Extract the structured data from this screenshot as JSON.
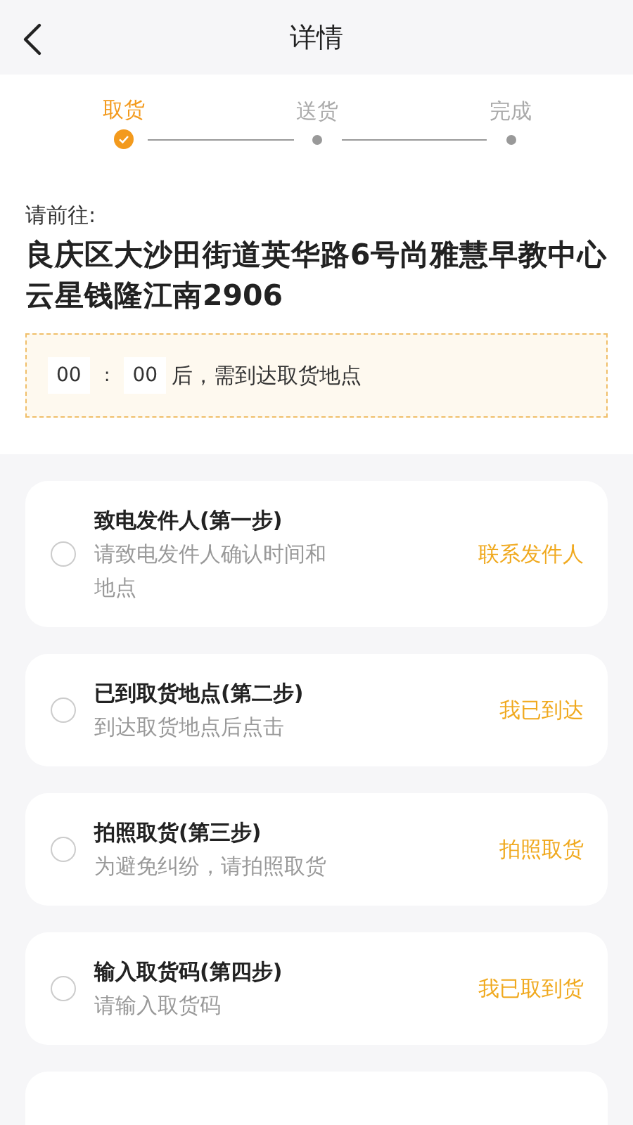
{
  "header": {
    "title": "详情"
  },
  "progress": [
    {
      "label": "取货",
      "done": true
    },
    {
      "label": "送货",
      "done": false
    },
    {
      "label": "完成",
      "done": false
    }
  ],
  "destination": {
    "label": "请前往:",
    "address": "良庆区大沙田街道英华路6号尚雅慧早教中心云星钱隆江南2906"
  },
  "countdown": {
    "hours": "00",
    "separator": ":",
    "minutes": "00",
    "message": "后，需到达取货地点"
  },
  "tasks": [
    {
      "title": "致电发件人(第一步)",
      "hint": "请致电发件人确认时间和地点",
      "action": "联系发件人",
      "checked": false
    },
    {
      "title": "已到取货地点(第二步)",
      "hint": "到达取货地点后点击",
      "action": "我已到达",
      "checked": false
    },
    {
      "title": "拍照取货(第三步)",
      "hint": "为避免纠纷，请拍照取货",
      "action": "拍照取货",
      "checked": false
    },
    {
      "title": "输入取货码(第四步)",
      "hint": "请输入取货码",
      "action": "我已取到货",
      "checked": false
    }
  ]
}
